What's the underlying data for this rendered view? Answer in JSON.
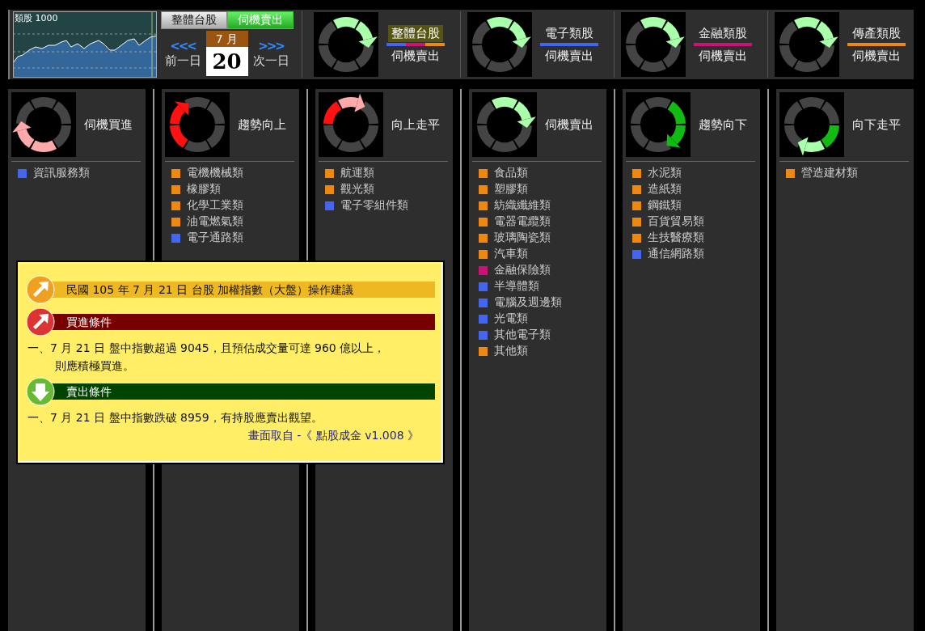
{
  "index_chart": {
    "label": "類股 1000"
  },
  "mode_tabs": [
    {
      "label": "整體台股",
      "selected": false
    },
    {
      "label": "伺機賣出",
      "selected": true
    }
  ],
  "date_nav": {
    "prev_arrows": "<<<",
    "prev_label": "前一日",
    "month": "7 月",
    "day": "20",
    "next_arrows": ">>>",
    "next_label": "次一日"
  },
  "indicators": [
    {
      "title": "整體台股",
      "status": "伺機賣出",
      "kind": "sell-watch",
      "selected": true,
      "bar": [
        {
          "color": "#4466ee"
        },
        {
          "color": "#cc1177"
        },
        {
          "color": "#ee8811"
        }
      ]
    },
    {
      "title": "電子類股",
      "status": "伺機賣出",
      "kind": "sell-watch",
      "selected": false,
      "bar": [
        {
          "color": "#4466ee"
        }
      ]
    },
    {
      "title": "金融類股",
      "status": "伺機賣出",
      "kind": "sell-watch",
      "selected": false,
      "bar": [
        {
          "color": "#cc1177"
        }
      ]
    },
    {
      "title": "傳產類股",
      "status": "伺機賣出",
      "kind": "sell-watch",
      "selected": false,
      "bar": [
        {
          "color": "#ee8811"
        }
      ]
    }
  ],
  "columns": [
    {
      "status": "伺機買進",
      "kind": "buy-watch",
      "sectors": [
        {
          "name": "資訊服務類",
          "color": "#4466ee"
        }
      ]
    },
    {
      "status": "趨勢向上",
      "kind": "trend-up",
      "sectors": [
        {
          "name": "電機機械類",
          "color": "#ee8811"
        },
        {
          "name": "橡膠類",
          "color": "#ee8811"
        },
        {
          "name": "化學工業類",
          "color": "#ee8811"
        },
        {
          "name": "油電燃氣類",
          "color": "#ee8811"
        },
        {
          "name": "電子通路類",
          "color": "#4466ee"
        }
      ]
    },
    {
      "status": "向上走平",
      "kind": "up-flat",
      "sectors": [
        {
          "name": "航運類",
          "color": "#ee8811"
        },
        {
          "name": "觀光類",
          "color": "#ee8811"
        },
        {
          "name": "電子零組件類",
          "color": "#4466ee"
        }
      ]
    },
    {
      "status": "伺機賣出",
      "kind": "sell-watch",
      "sectors": [
        {
          "name": "食品類",
          "color": "#ee8811"
        },
        {
          "name": "塑膠類",
          "color": "#ee8811"
        },
        {
          "name": "紡織纖維類",
          "color": "#ee8811"
        },
        {
          "name": "電器電纜類",
          "color": "#ee8811"
        },
        {
          "name": "玻璃陶瓷類",
          "color": "#ee8811"
        },
        {
          "name": "汽車類",
          "color": "#ee8811"
        },
        {
          "name": "金融保險類",
          "color": "#cc1177"
        },
        {
          "name": "半導體類",
          "color": "#4466ee"
        },
        {
          "name": "電腦及週邊類",
          "color": "#4466ee"
        },
        {
          "name": "光電類",
          "color": "#4466ee"
        },
        {
          "name": "其他電子類",
          "color": "#4466ee"
        },
        {
          "name": "其他類",
          "color": "#ee8811"
        }
      ]
    },
    {
      "status": "趨勢向下",
      "kind": "trend-down",
      "sectors": [
        {
          "name": "水泥類",
          "color": "#ee8811"
        },
        {
          "name": "造紙類",
          "color": "#ee8811"
        },
        {
          "name": "鋼鐵類",
          "color": "#ee8811"
        },
        {
          "name": "百貨貿易類",
          "color": "#ee8811"
        },
        {
          "name": "生技醫療類",
          "color": "#ee8811"
        },
        {
          "name": "通信網路類",
          "color": "#4466ee"
        }
      ]
    },
    {
      "status": "向下走平",
      "kind": "down-flat",
      "sectors": [
        {
          "name": "營造建材類",
          "color": "#ee8811"
        }
      ]
    }
  ],
  "advice_popup": {
    "sections": [
      {
        "kind": "info",
        "header": "民國 105 年 7 月 21 日 台股 加權指數（大盤）操作建議"
      },
      {
        "kind": "buy",
        "header": "買進條件",
        "lines": [
          "一、7 月 21 日 盤中指數超過 9045，且預估成交量可達 960 億以上，",
          "則應積極買進。"
        ]
      },
      {
        "kind": "sell",
        "header": "賣出條件",
        "lines": [
          "一、7 月 21 日 盤中指數跌破 8959，有持股應賣出觀望。"
        ]
      }
    ],
    "source": "畫面取自 -《 點股成金 v1.008 》"
  }
}
